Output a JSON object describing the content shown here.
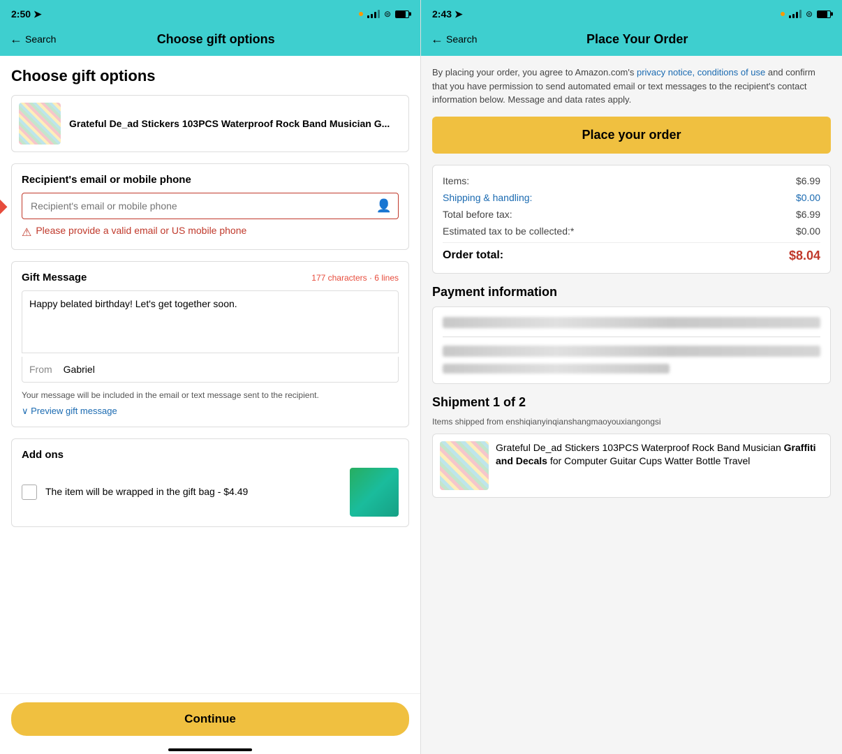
{
  "left": {
    "status": {
      "time": "2:50",
      "signal_dot": true
    },
    "nav": {
      "back_label": "Search",
      "title": "Choose gift options"
    },
    "page_heading": "Choose gift options",
    "product": {
      "title": "Grateful De_ad Stickers 103PCS Waterproof Rock Band Musician G..."
    },
    "recipient_section": {
      "label": "Recipient's email or mobile phone",
      "input_placeholder": "Recipient's email or mobile phone",
      "error_text": "Please provide a valid email or US mobile phone"
    },
    "gift_message": {
      "label": "Gift Message",
      "char_count": "177 characters · 6 lines",
      "message_text": "Happy belated birthday! Let's get together soon.",
      "from_label": "From",
      "from_value": "Gabriel",
      "note": "Your message will be included in the email or text message sent to the recipient.",
      "preview_label": "∨ Preview gift message"
    },
    "addons": {
      "heading": "Add ons",
      "item_text": "The item will be wrapped in the gift bag - $4.49"
    },
    "continue_btn": "Continue"
  },
  "right": {
    "status": {
      "time": "2:43"
    },
    "nav": {
      "back_label": "Search",
      "title": "Place Your Order"
    },
    "legal_text_1": "By placing your order, you agree to Amazon.com's ",
    "legal_link1": "privacy notice,",
    "legal_text_2": " ",
    "legal_link2": "conditions of use",
    "legal_text_3": " and confirm that you have permission to send automated email or text messages to the recipient's contact information below. Message and data rates apply.",
    "place_order_btn": "Place your order",
    "order_summary": {
      "items_label": "Items:",
      "items_value": "$6.99",
      "shipping_label": "Shipping & handling:",
      "shipping_value": "$0.00",
      "tax_before_label": "Total before tax:",
      "tax_before_value": "$6.99",
      "est_tax_label": "Estimated tax to be collected:*",
      "est_tax_value": "$0.00",
      "total_label": "Order total:",
      "total_value": "$8.04"
    },
    "payment_heading": "Payment information",
    "shipment_heading": "Shipment 1 of 2",
    "seller_text": "Items shipped from enshiqianyinqianshangmaoyouxiangongsi",
    "shipment_product": {
      "title_normal": "Grateful De_ad Stickers 103PCS Waterproof Rock Band Musician ",
      "title_bold": "Graffiti and Decals",
      "title_end": " for Computer Guitar Cups Watter Bottle Travel"
    }
  }
}
